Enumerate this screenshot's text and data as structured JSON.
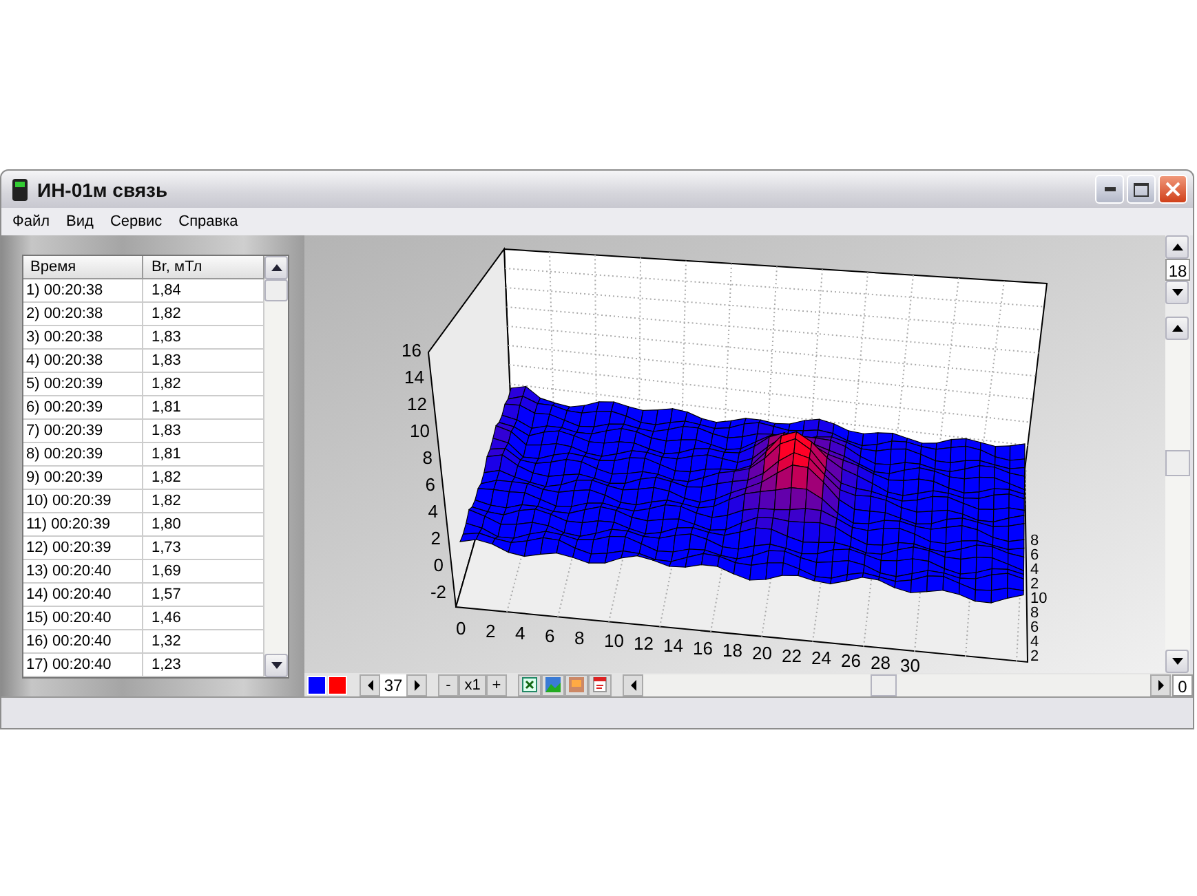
{
  "window": {
    "title": "ИН-01м связь"
  },
  "menu": [
    "Файл",
    "Вид",
    "Сервис",
    "Справка"
  ],
  "table": {
    "columns": [
      "Время",
      "Br, мТл"
    ],
    "rows": [
      [
        "1) 00:20:38",
        "1,84"
      ],
      [
        "2) 00:20:38",
        "1,82"
      ],
      [
        "3) 00:20:38",
        "1,83"
      ],
      [
        "4) 00:20:38",
        "1,83"
      ],
      [
        "5) 00:20:39",
        "1,82"
      ],
      [
        "6) 00:20:39",
        "1,81"
      ],
      [
        "7) 00:20:39",
        "1,83"
      ],
      [
        "8) 00:20:39",
        "1,81"
      ],
      [
        "9) 00:20:39",
        "1,82"
      ],
      [
        "10) 00:20:39",
        "1,82"
      ],
      [
        "11) 00:20:39",
        "1,80"
      ],
      [
        "12) 00:20:39",
        "1,73"
      ],
      [
        "13) 00:20:40",
        "1,69"
      ],
      [
        "14) 00:20:40",
        "1,57"
      ],
      [
        "15) 00:20:40",
        "1,46"
      ],
      [
        "16) 00:20:40",
        "1,32"
      ],
      [
        "17) 00:20:40",
        "1,23"
      ]
    ]
  },
  "chart": {
    "z_ticks": [
      "16",
      "14",
      "12",
      "10",
      "8",
      "6",
      "4",
      "2",
      "0",
      "-2"
    ],
    "x_ticks": [
      "0",
      "2",
      "4",
      "6",
      "8",
      "10",
      "12",
      "14",
      "16",
      "18",
      "20",
      "22",
      "24",
      "26",
      "28",
      "30"
    ],
    "depth_ticks": [
      "8",
      "6",
      "4",
      "2",
      "10",
      "8",
      "6",
      "4",
      "2"
    ]
  },
  "side_spinner": {
    "value": "18"
  },
  "toolbar": {
    "swatches": [
      {
        "color": "#0000ff"
      },
      {
        "color": "#ff0000"
      }
    ],
    "frame": "37",
    "zoom_out": "-",
    "zoom": "x1",
    "zoom_in": "+",
    "scroll_value": "0"
  }
}
